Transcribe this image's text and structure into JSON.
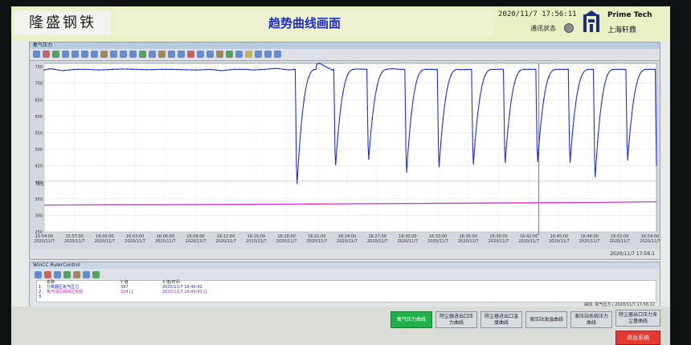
{
  "header": {
    "brand": "隆盛钢铁",
    "title": "趋势曲线画面",
    "datetime": "2020/11/7  17:56:11",
    "comm_label": "通讯状态",
    "company_en": "Prime Tech",
    "company_cn": "上海轩鼎"
  },
  "trend": {
    "window_title": "氧气压力",
    "status_value": "2020/11/7  17:56:1",
    "lower_label": "阀位"
  },
  "ruler": {
    "title": "WinCC RulerControl",
    "headers": [
      "名称",
      "Y 值",
      "X 值/时间"
    ],
    "rows": [
      {
        "name": "分离器压氧气压力",
        "y": "397",
        "x": "2020/11/7 16:40:42",
        "color": "#1a2ad6"
      },
      {
        "name": "氧气减压阀阀位反馈",
        "y": "324 []",
        "x": "2020/11/7 16:40:43 []",
        "color": "#c020c0"
      },
      {
        "name": "",
        "y": "",
        "x": "",
        "color": "#222"
      }
    ],
    "status": "曲线: 氧气压力 | 2020/11/7 17:56:12"
  },
  "buttons": [
    {
      "label": "氧气压力曲线",
      "active": true
    },
    {
      "label": "除尘器进出口压力曲线",
      "active": false
    },
    {
      "label": "除尘器进出口温度曲线",
      "active": false
    },
    {
      "label": "液压站油温曲线",
      "active": false
    },
    {
      "label": "液压站系统压力曲线",
      "active": false
    },
    {
      "label": "除尘器出口压力含尘量曲线",
      "active": false
    }
  ],
  "exit_label": "退出系统",
  "chart_data": {
    "type": "line",
    "ylim": [
      250,
      760
    ],
    "yticks": [
      750,
      700,
      650,
      600,
      550,
      500,
      450,
      400,
      350,
      300,
      250
    ],
    "xtick_times": [
      "15:54:00",
      "15:57:00",
      "16:00:00",
      "16:03:00",
      "16:06:00",
      "16:09:00",
      "16:12:00",
      "16:15:00",
      "16:18:00",
      "16:21:00",
      "16:24:00",
      "16:27:00",
      "16:30:00",
      "16:33:00",
      "16:36:00",
      "16:39:00",
      "16:42:00",
      "16:45:00",
      "16:48:00",
      "16:51:00",
      "16:54:00"
    ],
    "xtick_date": "2020/11/7",
    "series": [
      {
        "color": "#1f2fd6",
        "x": [
          0,
          1,
          3,
          5,
          7,
          9,
          11,
          13,
          15,
          17,
          19,
          21,
          23,
          25,
          27,
          29,
          31,
          33,
          34,
          36,
          38,
          40,
          42,
          45,
          47,
          49,
          51,
          53,
          55,
          57,
          58,
          59,
          61,
          63,
          65,
          67,
          68,
          70,
          72,
          74,
          76,
          78,
          80,
          82,
          84,
          86,
          87,
          88,
          90,
          92,
          94,
          96,
          98,
          100
        ],
        "y": [
          740,
          744,
          738,
          742,
          742,
          740,
          742,
          743,
          742,
          741,
          742,
          742,
          741,
          740,
          742,
          738,
          742,
          742,
          740,
          742,
          745,
          740,
          745,
          760,
          740,
          742,
          743,
          742,
          742,
          744,
          742,
          742,
          742,
          742,
          742,
          742,
          741,
          742,
          742,
          742,
          743,
          742,
          742,
          743,
          742,
          742,
          742,
          742,
          742,
          742,
          742,
          742,
          742,
          742
        ]
      },
      {
        "color": "#d62ad6",
        "x": [
          0,
          10,
          20,
          30,
          40,
          50,
          60,
          70,
          80,
          90,
          100
        ],
        "y": [
          331,
          332,
          332,
          333,
          334,
          335,
          336,
          337,
          338,
          339,
          341
        ]
      }
    ],
    "dips": [
      {
        "start": 41.0,
        "min": 378
      },
      {
        "start": 47.3,
        "min": 438
      },
      {
        "start": 52.7,
        "min": 455
      },
      {
        "start": 58.9,
        "min": 417
      },
      {
        "start": 64.2,
        "min": 432
      },
      {
        "start": 69.8,
        "min": 440
      },
      {
        "start": 75.0,
        "min": 445
      },
      {
        "start": 80.3,
        "min": 448
      },
      {
        "start": 85.6,
        "min": 446
      },
      {
        "start": 89.7,
        "min": 400
      },
      {
        "start": 95.0,
        "min": 452
      },
      {
        "start": 99.8,
        "min": 380
      }
    ]
  }
}
